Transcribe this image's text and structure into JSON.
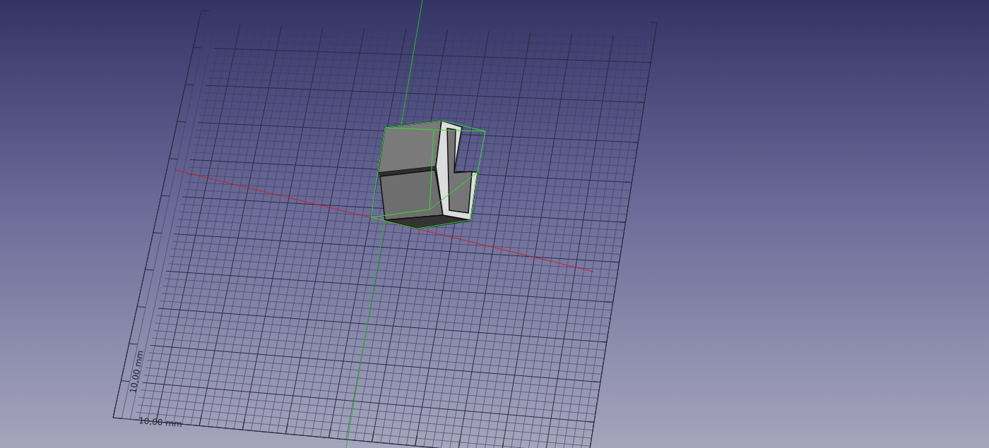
{
  "viewport": {
    "scale_labels": [
      {
        "text": "10,00 mm"
      },
      {
        "text": "10,00 mm"
      }
    ]
  }
}
